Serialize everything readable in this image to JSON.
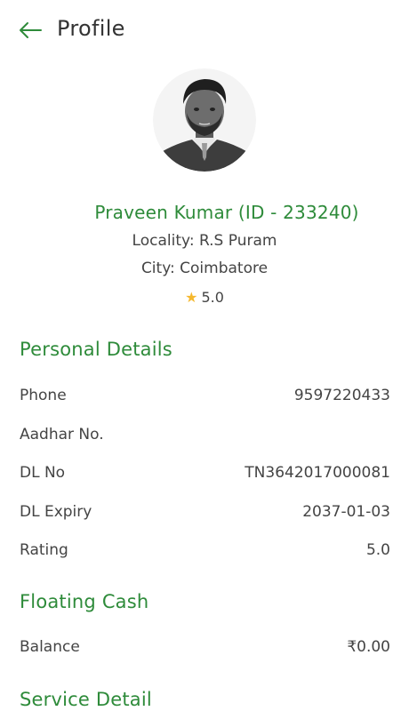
{
  "header": {
    "title": "Profile",
    "back_icon": "arrow-left-icon"
  },
  "profile": {
    "avatar_icon": "user-photo",
    "name": "Praveen Kumar (ID - 233240)",
    "locality": "Locality: R.S Puram",
    "city": "City: Coimbatore",
    "rating_star": "★",
    "rating": "5.0"
  },
  "personal_details": {
    "heading": "Personal Details",
    "rows": [
      {
        "label": "Phone",
        "value": "9597220433"
      },
      {
        "label": "Aadhar No.",
        "value": ""
      },
      {
        "label": "DL No",
        "value": "TN3642017000081"
      },
      {
        "label": "DL Expiry",
        "value": "2037-01-03"
      },
      {
        "label": "Rating",
        "value": "5.0"
      }
    ]
  },
  "floating_cash": {
    "heading": "Floating Cash",
    "rows": [
      {
        "label": "Balance",
        "value": "₹0.00"
      }
    ]
  },
  "service_detail": {
    "heading": "Service Detail"
  },
  "colors": {
    "accent_green": "#2e8b3a",
    "star": "#f5b82e",
    "text": "#444444"
  }
}
